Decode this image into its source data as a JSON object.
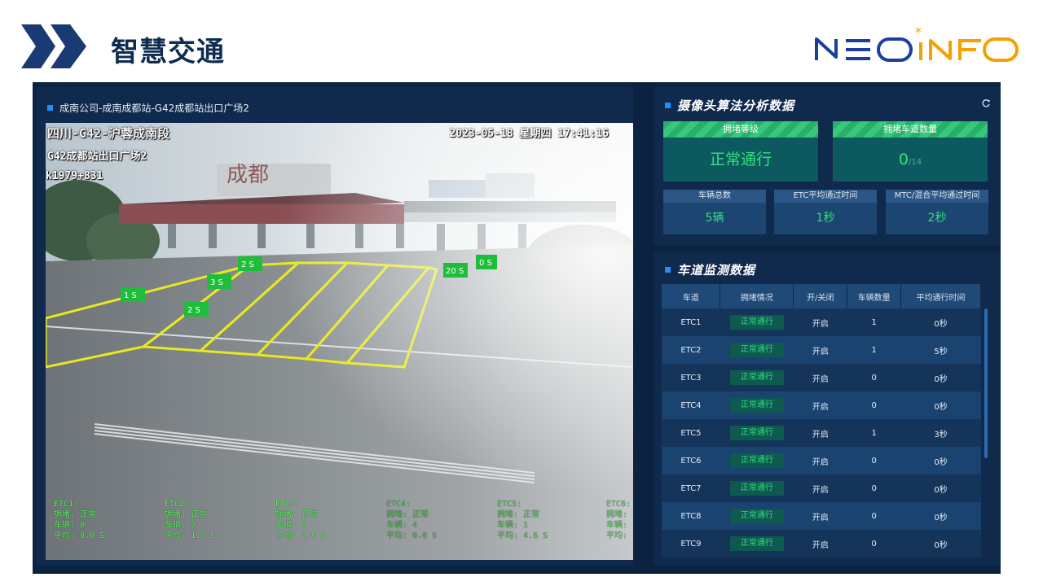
{
  "header": {
    "title": "智慧交通",
    "logo_text": "NEO INFO"
  },
  "video": {
    "caption": "成南公司-成南成都站-G42成都站出口广场2",
    "overlay_location": "四川-G42-沪蓉成南段",
    "overlay_datetime": "2023-05-18 星期四 17:41:16",
    "overlay_plaza": "G42成都站出口广场2",
    "overlay_km": "k1979+831",
    "sign_text": "成都",
    "lane_tags": [
      {
        "label": "2 S"
      },
      {
        "label": "3 S"
      },
      {
        "label": "1 S"
      },
      {
        "label": "2 S"
      },
      {
        "label": "20 S"
      },
      {
        "label": "0 S"
      }
    ],
    "stats": [
      {
        "lane": "ETC1:",
        "jam": "拥堵: 正常",
        "cars": "车辆: 0",
        "avg": "平均: 0.0 S"
      },
      {
        "lane": "ETC2:",
        "jam": "拥堵: 正常",
        "cars": "车辆: 2",
        "avg": "平均: 1.6 S"
      },
      {
        "lane": "ETC3:",
        "jam": "拥堵: 正常",
        "cars": "车辆: 2",
        "avg": "平均: 2.9 S"
      },
      {
        "lane": "ETC4:",
        "jam": "拥堵: 正常",
        "cars": "车辆: 4",
        "avg": "平均: 0.0 S"
      },
      {
        "lane": "ETC5:",
        "jam": "拥堵: 正常",
        "cars": "车辆: 1",
        "avg": "平均: 4.6 S"
      },
      {
        "lane": "ETC6:",
        "jam": "拥堵:",
        "cars": "车辆:",
        "avg": "平均:"
      }
    ]
  },
  "camera": {
    "title": "摄像头算法分析数据",
    "congestion_level_label": "拥堵等级",
    "congestion_level_value": "正常通行",
    "congested_lanes_label": "拥堵车道数量",
    "congested_lanes_value": "0",
    "congested_lanes_total": "/14",
    "total_vehicles_label": "车辆总数",
    "total_vehicles_value": "5辆",
    "etc_avg_label": "ETC平均通过时间",
    "etc_avg_value": "1秒",
    "mtc_avg_label": "MTC/混合平均通过时间",
    "mtc_avg_value": "2秒"
  },
  "lanes": {
    "title": "车道监测数据",
    "headers": [
      "车道",
      "拥堵情况",
      "开/关闭",
      "车辆数量",
      "平均通行时间"
    ],
    "rows": [
      {
        "lane": "ETC1",
        "status": "正常通行",
        "open": "开启",
        "count": "1",
        "avg": "0秒"
      },
      {
        "lane": "ETC2",
        "status": "正常通行",
        "open": "开启",
        "count": "1",
        "avg": "5秒"
      },
      {
        "lane": "ETC3",
        "status": "正常通行",
        "open": "开启",
        "count": "0",
        "avg": "0秒"
      },
      {
        "lane": "ETC4",
        "status": "正常通行",
        "open": "开启",
        "count": "0",
        "avg": "0秒"
      },
      {
        "lane": "ETC5",
        "status": "正常通行",
        "open": "开启",
        "count": "1",
        "avg": "3秒"
      },
      {
        "lane": "ETC6",
        "status": "正常通行",
        "open": "开启",
        "count": "0",
        "avg": "0秒"
      },
      {
        "lane": "ETC7",
        "status": "正常通行",
        "open": "开启",
        "count": "0",
        "avg": "0秒"
      },
      {
        "lane": "ETC8",
        "status": "正常通行",
        "open": "开启",
        "count": "0",
        "avg": "0秒"
      },
      {
        "lane": "ETC9",
        "status": "正常通行",
        "open": "开启",
        "count": "0",
        "avg": "0秒"
      }
    ]
  },
  "colors": {
    "accent_green": "#33e27c",
    "panel_bg": "#0f2a4c",
    "title_navy": "#0d2c4f",
    "logo_blue": "#1a3fa0",
    "logo_orange": "#f5a000"
  }
}
